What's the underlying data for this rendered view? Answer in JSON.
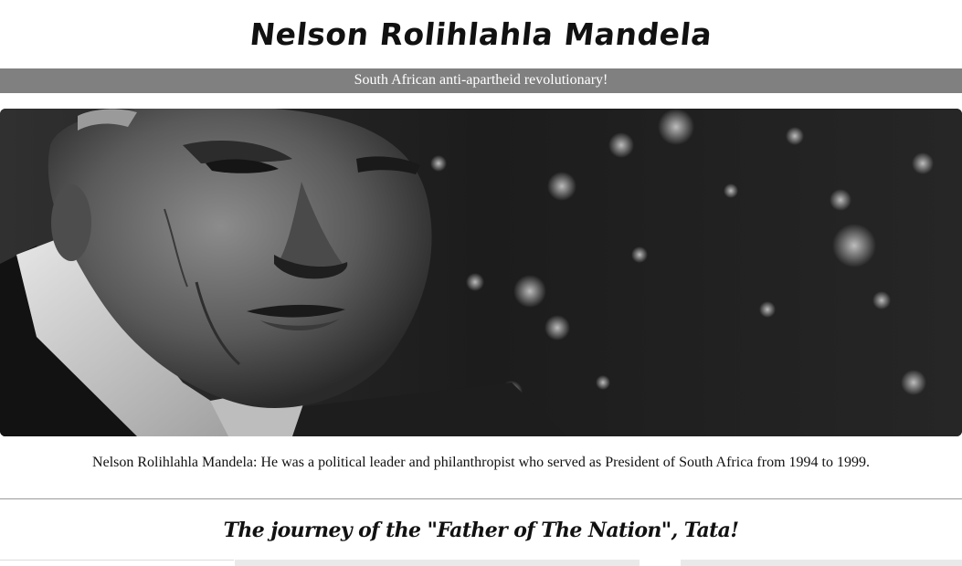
{
  "header": {
    "title": "Nelson Rolihlahla Mandela",
    "subtitle": "South African anti-apartheid revolutionary!"
  },
  "hero": {
    "image_name": "mandela-portrait-image"
  },
  "caption": {
    "text": "Nelson Rolihlahla Mandela: He was a political leader and philanthropist who served as President of South Africa from 1994 to 1999."
  },
  "timeline": {
    "heading": "The journey of the \"Father of The Nation\", Tata!"
  },
  "colors": {
    "subtitle_bar": "#808080",
    "text": "#111111",
    "background": "#ffffff"
  }
}
